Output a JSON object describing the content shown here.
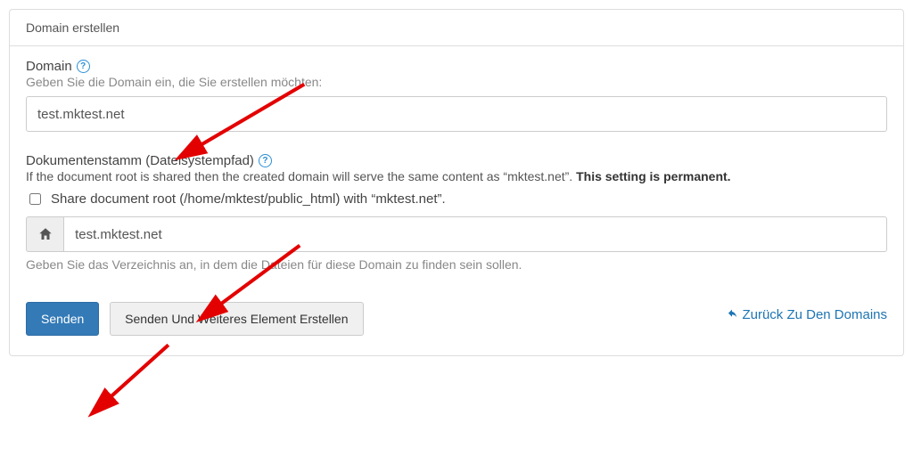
{
  "panel": {
    "title": "Domain erstellen"
  },
  "domain": {
    "label": "Domain",
    "help": "Geben Sie die Domain ein, die Sie erstellen möchten:",
    "value": "test.mktest.net"
  },
  "docroot": {
    "label": "Dokumentenstamm (Dateisystempfad)",
    "help_prefix": "If the document root is shared then the created domain will serve the same content as “mktest.net”. ",
    "help_strong": "This setting is permanent.",
    "share_label": "Share document root (/home/mktest/public_html) with “mktest.net”.",
    "value": "test.mktest.net",
    "below_help": "Geben Sie das Verzeichnis an, in dem die Dateien für diese Domain zu finden sein sollen."
  },
  "actions": {
    "submit": "Senden",
    "submit_and_another": "Senden Und Weiteres Element Erstellen",
    "back": "Zurück Zu Den Domains"
  }
}
